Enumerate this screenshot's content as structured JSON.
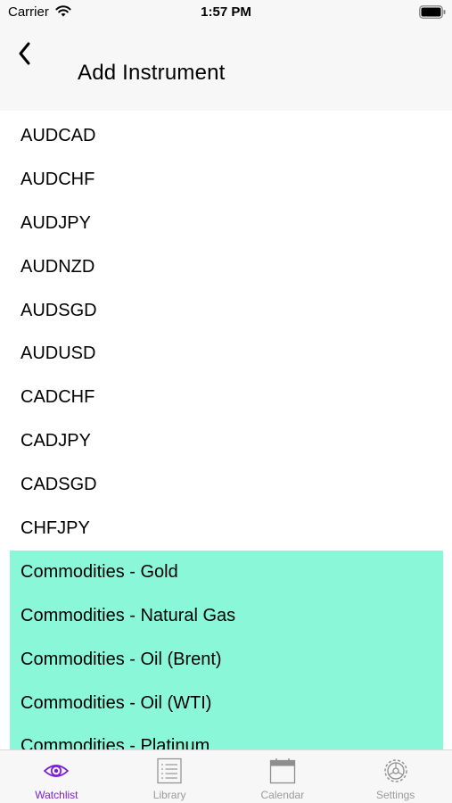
{
  "status_bar": {
    "carrier": "Carrier",
    "time": "1:57 PM"
  },
  "nav": {
    "title": "Add Instrument",
    "back_icon": "chevron-left-icon"
  },
  "instruments": [
    {
      "label": "AUDCAD",
      "highlighted": false
    },
    {
      "label": "AUDCHF",
      "highlighted": false
    },
    {
      "label": "AUDJPY",
      "highlighted": false
    },
    {
      "label": "AUDNZD",
      "highlighted": false
    },
    {
      "label": "AUDSGD",
      "highlighted": false
    },
    {
      "label": "AUDUSD",
      "highlighted": false
    },
    {
      "label": "CADCHF",
      "highlighted": false
    },
    {
      "label": "CADJPY",
      "highlighted": false
    },
    {
      "label": "CADSGD",
      "highlighted": false
    },
    {
      "label": "CHFJPY",
      "highlighted": false
    },
    {
      "label": "Commodities - Gold",
      "highlighted": true
    },
    {
      "label": "Commodities - Natural Gas",
      "highlighted": true
    },
    {
      "label": "Commodities - Oil (Brent)",
      "highlighted": true
    },
    {
      "label": "Commodities - Oil (WTI)",
      "highlighted": true
    },
    {
      "label": "Commodities - Platinum",
      "highlighted": true
    }
  ],
  "tabs": [
    {
      "label": "Watchlist",
      "icon": "eye-icon",
      "active": true
    },
    {
      "label": "Library",
      "icon": "list-icon",
      "active": false
    },
    {
      "label": "Calendar",
      "icon": "calendar-icon",
      "active": false
    },
    {
      "label": "Settings",
      "icon": "gear-icon",
      "active": false
    }
  ],
  "colors": {
    "highlight": "#8af7d9",
    "accent": "#7b1fd9",
    "inactive_tab": "#9a9a9a",
    "bar_background": "#f7f7f7"
  }
}
